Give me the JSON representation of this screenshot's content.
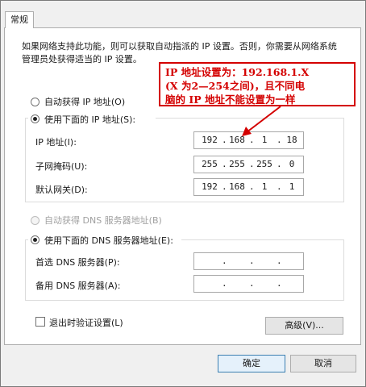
{
  "tab": {
    "label": "常规"
  },
  "description": "如果网络支持此功能，则可以获取自动指派的 IP 设置。否则，你需要从网络系统管理员处获得适当的 IP 设置。",
  "ip": {
    "auto_label": "自动获得 IP 地址(O)",
    "manual_label": "使用下面的 IP 地址(S):",
    "address_label": "IP 地址(I):",
    "address": [
      "192",
      "168",
      "1",
      "18"
    ],
    "mask_label": "子网掩码(U):",
    "mask": [
      "255",
      "255",
      "255",
      "0"
    ],
    "gateway_label": "默认网关(D):",
    "gateway": [
      "192",
      "168",
      "1",
      "1"
    ]
  },
  "dns": {
    "auto_label": "自动获得 DNS 服务器地址(B)",
    "manual_label": "使用下面的 DNS 服务器地址(E):",
    "preferred_label": "首选 DNS 服务器(P):",
    "alternate_label": "备用 DNS 服务器(A):"
  },
  "validate_label": "退出时验证设置(L)",
  "advanced_label": "高级(V)...",
  "ok_label": "确定",
  "cancel_label": "取消",
  "annotation": "IP 地址设置为：192.168.1.X\n(X 为2—254之间)，且不同电\n脑的 IP 地址不能设置为一样",
  "colors": {
    "annotation": "#d40000",
    "primary_border": "#3c7fb1"
  }
}
